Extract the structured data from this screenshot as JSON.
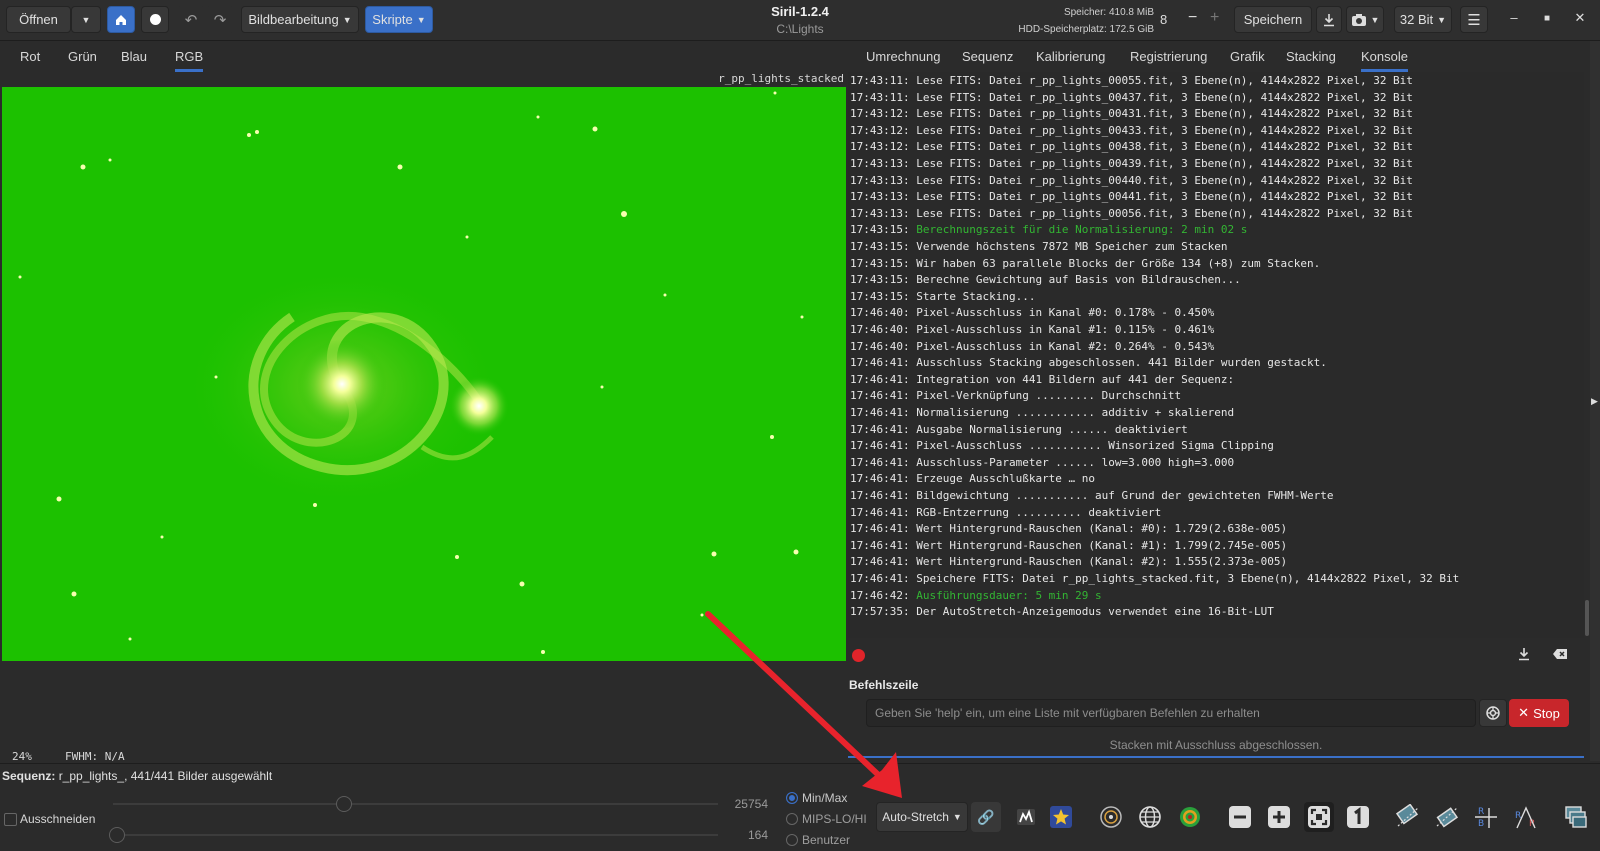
{
  "header": {
    "open_label": "Öffnen",
    "image_processing_label": "Bildbearbeitung",
    "scripts_label": "Skripte",
    "app_title": "Siril-1.2.4",
    "working_dir": "C:\\Lights",
    "memory": "Speicher: 410.8 MiB",
    "disk": "HDD-Speicherplatz: 172.5 GiB",
    "threads": "8",
    "save_label": "Speichern",
    "bit_depth": "32 Bit"
  },
  "left_tabs": [
    "Rot",
    "Grün",
    "Blau",
    "RGB"
  ],
  "image": {
    "name": "r_pp_lights_stacked",
    "background_color": "#1cc100"
  },
  "image_info": {
    "zoom": "24%",
    "fwhm": "FWHM: N/A"
  },
  "right_tabs": [
    "Umrechnung",
    "Sequenz",
    "Kalibrierung",
    "Registrierung",
    "Grafik",
    "Stacking",
    "Konsole"
  ],
  "console": [
    {
      "t": "17:43:11:",
      "m": "Lese FITS: Datei r_pp_lights_00055.fit, 3 Ebene(n), 4144x2822 Pixel, 32 Bit",
      "hl": false
    },
    {
      "t": "17:43:11:",
      "m": "Lese FITS: Datei r_pp_lights_00437.fit, 3 Ebene(n), 4144x2822 Pixel, 32 Bit",
      "hl": false
    },
    {
      "t": "17:43:12:",
      "m": "Lese FITS: Datei r_pp_lights_00431.fit, 3 Ebene(n), 4144x2822 Pixel, 32 Bit",
      "hl": false
    },
    {
      "t": "17:43:12:",
      "m": "Lese FITS: Datei r_pp_lights_00433.fit, 3 Ebene(n), 4144x2822 Pixel, 32 Bit",
      "hl": false
    },
    {
      "t": "17:43:12:",
      "m": "Lese FITS: Datei r_pp_lights_00438.fit, 3 Ebene(n), 4144x2822 Pixel, 32 Bit",
      "hl": false
    },
    {
      "t": "17:43:13:",
      "m": "Lese FITS: Datei r_pp_lights_00439.fit, 3 Ebene(n), 4144x2822 Pixel, 32 Bit",
      "hl": false
    },
    {
      "t": "17:43:13:",
      "m": "Lese FITS: Datei r_pp_lights_00440.fit, 3 Ebene(n), 4144x2822 Pixel, 32 Bit",
      "hl": false
    },
    {
      "t": "17:43:13:",
      "m": "Lese FITS: Datei r_pp_lights_00441.fit, 3 Ebene(n), 4144x2822 Pixel, 32 Bit",
      "hl": false
    },
    {
      "t": "17:43:13:",
      "m": "Lese FITS: Datei r_pp_lights_00056.fit, 3 Ebene(n), 4144x2822 Pixel, 32 Bit",
      "hl": false
    },
    {
      "t": "17:43:15:",
      "m": "Berechnungszeit für die Normalisierung: 2 min 02 s",
      "hl": true
    },
    {
      "t": "17:43:15:",
      "m": "Verwende höchstens 7872 MB Speicher zum Stacken",
      "hl": false
    },
    {
      "t": "17:43:15:",
      "m": "Wir haben 63 parallele Blocks der Größe 134 (+8) zum Stacken.",
      "hl": false
    },
    {
      "t": "17:43:15:",
      "m": "Berechne Gewichtung auf Basis von Bildrauschen...",
      "hl": false
    },
    {
      "t": "17:43:15:",
      "m": "Starte Stacking...",
      "hl": false
    },
    {
      "t": "17:46:40:",
      "m": "Pixel-Ausschluss in Kanal #0: 0.178% - 0.450%",
      "hl": false
    },
    {
      "t": "17:46:40:",
      "m": "Pixel-Ausschluss in Kanal #1: 0.115% - 0.461%",
      "hl": false
    },
    {
      "t": "17:46:40:",
      "m": "Pixel-Ausschluss in Kanal #2: 0.264% - 0.543%",
      "hl": false
    },
    {
      "t": "17:46:41:",
      "m": "Ausschluss Stacking abgeschlossen. 441 Bilder wurden gestackt.",
      "hl": false
    },
    {
      "t": "17:46:41:",
      "m": "Integration von 441 Bildern auf 441 der Sequenz:",
      "hl": false
    },
    {
      "t": "17:46:41:",
      "m": "Pixel-Verknüpfung ......... Durchschnitt",
      "hl": false
    },
    {
      "t": "17:46:41:",
      "m": "Normalisierung ............ additiv + skalierend",
      "hl": false
    },
    {
      "t": "17:46:41:",
      "m": "Ausgabe Normalisierung ...... deaktiviert",
      "hl": false
    },
    {
      "t": "17:46:41:",
      "m": "Pixel-Ausschluss ........... Winsorized Sigma Clipping",
      "hl": false
    },
    {
      "t": "17:46:41:",
      "m": "Ausschluss-Parameter ...... low=3.000 high=3.000",
      "hl": false
    },
    {
      "t": "17:46:41:",
      "m": "Erzeuge Ausschlußkarte … no",
      "hl": false
    },
    {
      "t": "17:46:41:",
      "m": "Bildgewichtung ........... auf Grund der gewichteten FWHM-Werte",
      "hl": false
    },
    {
      "t": "17:46:41:",
      "m": "RGB-Entzerrung .......... deaktiviert",
      "hl": false
    },
    {
      "t": "17:46:41:",
      "m": "Wert Hintergrund-Rauschen (Kanal: #0): 1.729(2.638e-005)",
      "hl": false
    },
    {
      "t": "17:46:41:",
      "m": "Wert Hintergrund-Rauschen (Kanal: #1): 1.799(2.745e-005)",
      "hl": false
    },
    {
      "t": "17:46:41:",
      "m": "Wert Hintergrund-Rauschen (Kanal: #2): 1.555(2.373e-005)",
      "hl": false
    },
    {
      "t": "17:46:41:",
      "m": "Speichere FITS: Datei r_pp_lights_stacked.fit, 3 Ebene(n), 4144x2822 Pixel, 32 Bit",
      "hl": false
    },
    {
      "t": "17:46:42:",
      "m": "Ausführungsdauer: 5 min 29 s",
      "hl": true
    },
    {
      "t": "17:57:35:",
      "m": "Der AutoStretch-Anzeigemodus verwendet eine 16-Bit-LUT",
      "hl": false
    }
  ],
  "command_line": {
    "label": "Befehlszeile",
    "placeholder": "Geben Sie 'help' ein, um eine Liste mit verfügbaren Befehlen zu erhalten",
    "stop_label": "Stop",
    "status": "Stacken mit Ausschluss abgeschlossen."
  },
  "bottom": {
    "sequence_label": "Sequenz:",
    "sequence_info": "r_pp_lights_, 441/441 Bilder ausgewählt",
    "crop_label": "Ausschneiden",
    "high_value": "25754",
    "low_value": "164",
    "high_slider_fraction": 0.38,
    "low_slider_fraction": 0.0,
    "scale_options": [
      "Min/Max",
      "MIPS-LO/HI",
      "Benutzer"
    ],
    "scale_selected": "Min/Max",
    "stretch_mode": "Auto-Stretch"
  },
  "colors": {
    "accent": "#3a70c8",
    "stop": "#c8262b",
    "console_highlight": "#33b533",
    "arrow": "#e8232c"
  },
  "icons": [
    "home-icon",
    "record-icon",
    "undo-icon",
    "redo-icon",
    "save-download-icon",
    "snapshot-icon",
    "hamburger-icon",
    "minimize-icon",
    "maximize-icon",
    "close-icon",
    "link-icon",
    "histogram-icon",
    "star-icon",
    "photometry-icon",
    "globe-icon",
    "target-icon",
    "zoom-out-icon",
    "zoom-in-icon",
    "fit-icon",
    "zoom-one-icon",
    "mirror-icon",
    "rotate-icon",
    "rgb-align-icon",
    "bayer-icon",
    "screen-icon"
  ]
}
